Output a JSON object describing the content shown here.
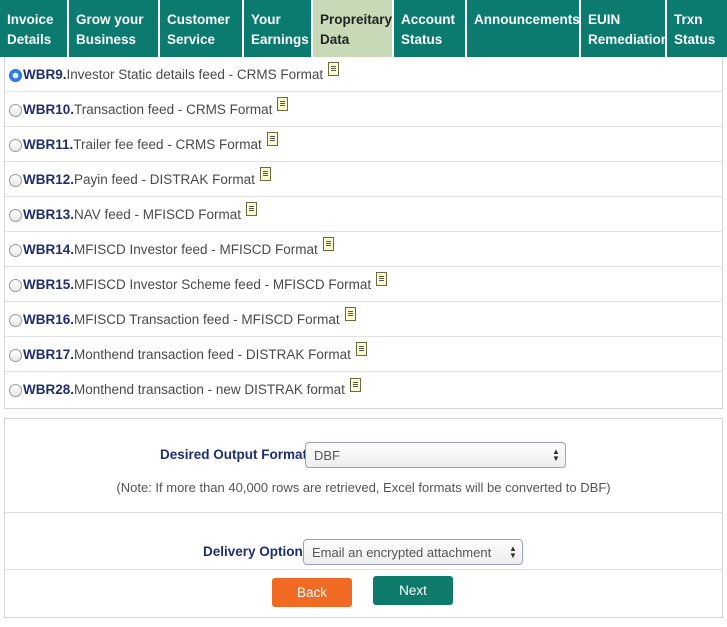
{
  "nav": {
    "tabs": [
      {
        "label": "Invoice Details",
        "active": false
      },
      {
        "label": "Grow your Business",
        "active": false
      },
      {
        "label": "Customer Service",
        "active": false
      },
      {
        "label": "Your Earnings",
        "active": false
      },
      {
        "label": "Propreitary Data",
        "active": true
      },
      {
        "label": "Account Status",
        "active": false
      },
      {
        "label": "Announcements",
        "active": false
      },
      {
        "label": "EUIN Remediation",
        "active": false
      },
      {
        "label": "Trxn Status",
        "active": false
      }
    ]
  },
  "reports": [
    {
      "code": "WBR9.",
      "description": " Investor Static details feed - CRMS Format",
      "selected": true
    },
    {
      "code": "WBR10.",
      "description": " Transaction feed - CRMS Format",
      "selected": false
    },
    {
      "code": "WBR11.",
      "description": " Trailer fee feed - CRMS Format",
      "selected": false
    },
    {
      "code": "WBR12.",
      "description": " Payin feed - DISTRAK Format",
      "selected": false
    },
    {
      "code": "WBR13.",
      "description": " NAV feed - MFISCD Format",
      "selected": false
    },
    {
      "code": "WBR14.",
      "description": " MFISCD Investor feed - MFISCD Format",
      "selected": false
    },
    {
      "code": "WBR15.",
      "description": " MFISCD Investor Scheme feed - MFISCD Format",
      "selected": false
    },
    {
      "code": "WBR16.",
      "description": " MFISCD Transaction feed - MFISCD Format",
      "selected": false
    },
    {
      "code": "WBR17.",
      "description": " Monthend transaction feed - DISTRAK Format",
      "selected": false
    },
    {
      "code": "WBR28.",
      "description": " Monthend transaction - new DISTRAK format",
      "selected": false
    }
  ],
  "output_format": {
    "label": "Desired Output Format",
    "value": "DBF",
    "note": "(Note: If more than 40,000 rows are retrieved, Excel formats will be converted to DBF)"
  },
  "delivery": {
    "label": "Delivery Option",
    "value": "Email an encrypted attachment"
  },
  "buttons": {
    "back": "Back",
    "next": "Next"
  },
  "colors": {
    "nav_bg": "#0a7b6e",
    "nav_active_bg": "#c8d9b8",
    "back_button": "#f06a23",
    "next_button": "#0e7a6c"
  },
  "icons": {
    "report_icon": "document-icon",
    "select_arrow": "updown-arrow-icon"
  }
}
